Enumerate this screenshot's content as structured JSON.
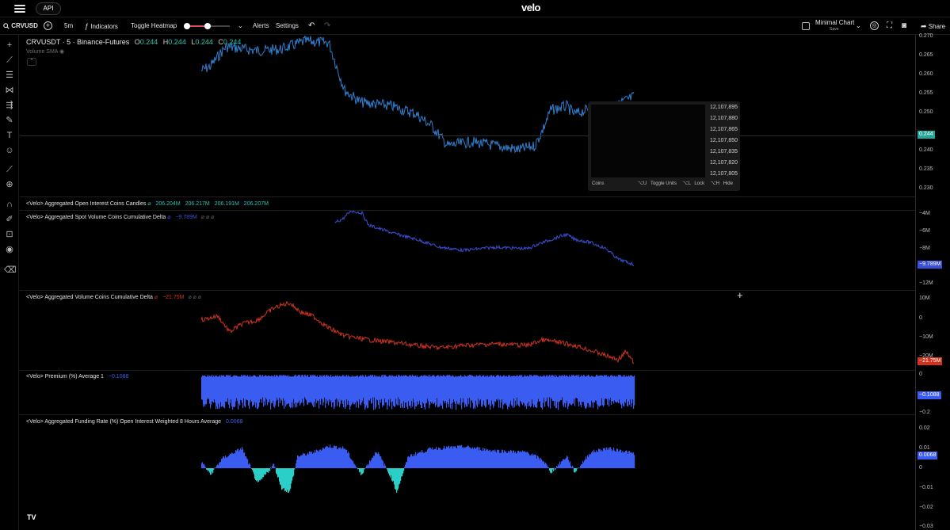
{
  "topbar": {
    "api_label": "API",
    "brand": "velo"
  },
  "toolbar": {
    "symbol": "CRVUSD",
    "interval": "5m",
    "indicators": "Indicators",
    "toggle_heatmap": "Toggle Heatmap",
    "alerts": "Alerts",
    "settings": "Settings",
    "minimal_chart": "Minimal Chart",
    "minimal_sub": "Save",
    "share": "Share"
  },
  "main": {
    "title": "CRVUSDT · 5 · Binance-Futures",
    "o": "0.244",
    "h": "0.244",
    "l": "0.244",
    "c": "0.244",
    "volume_sma": "Volume SMA",
    "price_axis": [
      "0.270",
      "0.265",
      "0.260",
      "0.255",
      "0.250",
      "0.245",
      "0.244",
      "0.240",
      "0.235",
      "0.230"
    ],
    "current_price": "0.244"
  },
  "tooltip": {
    "values": [
      "12,107,895",
      "12,107,880",
      "12,107,865",
      "12,107,850",
      "12,107,835",
      "12,107,820",
      "12,107,805"
    ],
    "coins": "Coins",
    "u_key": "⌥U",
    "toggle_units": "Toggle Units",
    "l_key": "⌥L",
    "lock": "Lock",
    "h_key": "⌥H",
    "hide": "Hide"
  },
  "panes": {
    "oi": {
      "label": "<Velo> Aggregated Open Interest Coins Candles",
      "v1": "206.204M",
      "v2": "206.217M",
      "v3": "206.191M",
      "v4": "206.207M"
    },
    "spot": {
      "label": "<Velo> Aggregated Spot Volume Coins Cumulative Delta",
      "value": "−9.789M",
      "axis": [
        "−4M",
        "−6M",
        "−8M",
        "−12M"
      ],
      "tag": "−9.789M"
    },
    "vol": {
      "label": "<Velo> Aggregated Volume Coins Cumulative Delta",
      "value": "−21.75M",
      "axis": [
        "10M",
        "0",
        "−10M",
        "−20M"
      ],
      "tag": "−21.75M"
    },
    "premium": {
      "label": "<Velo> Premium (%) Average 1",
      "value": "−0.1088",
      "axis": [
        "0",
        "−0.2"
      ],
      "tag": "−0.1088"
    },
    "funding": {
      "label": "<Velo> Aggregated Funding Rate (%) Open Interest Weighted 8 Hours Average",
      "value": "0.0068",
      "axis": [
        "0.02",
        "0.01",
        "0",
        "−0.01",
        "−0.02",
        "−0.03"
      ],
      "tag": "0.0068"
    }
  },
  "colors": {
    "price": "#2f7fd0",
    "spot": "#3a4fd8",
    "vol": "#d0321e",
    "premium": "#3b5cf0",
    "funding_pos": "#3b5cf0",
    "funding_neg": "#2ad0c8",
    "price_tag": "#26a69a"
  },
  "icons": [
    "search-icon",
    "plus-circle-icon",
    "indicators-icon",
    "chevron-down-icon",
    "undo-icon",
    "redo-icon",
    "settings-icon",
    "fullscreen-icon",
    "camera-icon",
    "share-icon"
  ]
}
